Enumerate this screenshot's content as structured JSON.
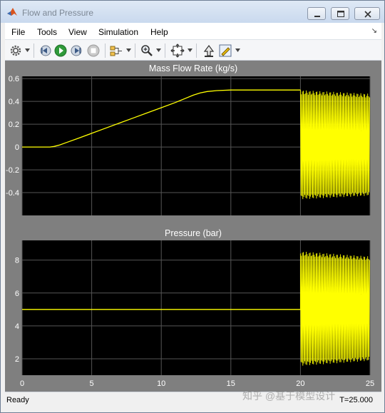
{
  "window": {
    "title": "Flow and Pressure"
  },
  "menu": {
    "items": [
      "File",
      "Tools",
      "View",
      "Simulation",
      "Help"
    ]
  },
  "toolbar": {
    "icons": [
      "gear-icon",
      "step-back-icon",
      "run-icon",
      "step-forward-icon",
      "stop-icon",
      "signal-select-icon",
      "zoom-icon",
      "fit-icon",
      "bring-to-front-icon",
      "highlight-icon"
    ]
  },
  "status": {
    "text": "Ready",
    "time": "T=25.000"
  },
  "watermark": "知乎 @基于模型设计",
  "colors": {
    "trace": "#ffff00",
    "plot_bg": "#000000",
    "frame_bg": "#7f7f7f",
    "grid": "#555555"
  },
  "chart_data": [
    {
      "type": "line",
      "title": "Mass Flow Rate (kg/s)",
      "xlim": [
        0,
        25
      ],
      "ylim": [
        -0.6,
        0.62
      ],
      "xticks": [
        0,
        5,
        10,
        15,
        20,
        25
      ],
      "yticks": [
        -0.4,
        -0.2,
        0,
        0.2,
        0.4,
        0.6
      ],
      "ytick_labels": [
        "-0.4",
        "-0.2",
        "0",
        "0.2",
        "0.4",
        "0.6"
      ],
      "show_xtick_labels": false,
      "grid": true,
      "series": [
        {
          "x": [
            0,
            2,
            2.3,
            2.7,
            3.2,
            4,
            5,
            6,
            7,
            8,
            9,
            10,
            11,
            11.7,
            12.3,
            12.8,
            13.3,
            14,
            15,
            16,
            17,
            18,
            19,
            20
          ],
          "y": [
            0,
            0,
            0.005,
            0.018,
            0.04,
            0.075,
            0.12,
            0.165,
            0.21,
            0.255,
            0.3,
            0.345,
            0.39,
            0.425,
            0.455,
            0.475,
            0.487,
            0.495,
            0.5,
            0.5,
            0.5,
            0.5,
            0.5,
            0.5
          ],
          "oscillation": {
            "from": 20,
            "to": 25,
            "center": 0.02,
            "amplitude_start": 0.46,
            "amplitude_end": 0.43,
            "period": 0.07
          }
        }
      ]
    },
    {
      "type": "line",
      "title": "Pressure (bar)",
      "xlim": [
        0,
        25
      ],
      "ylim": [
        1,
        9.2
      ],
      "xticks": [
        0,
        5,
        10,
        15,
        20,
        25
      ],
      "xtick_labels": [
        "0",
        "5",
        "10",
        "15",
        "20",
        "25"
      ],
      "yticks": [
        2,
        4,
        6,
        8
      ],
      "ytick_labels": [
        "2",
        "4",
        "6",
        "8"
      ],
      "grid": true,
      "series": [
        {
          "x": [
            0,
            20
          ],
          "y": [
            5,
            5
          ],
          "oscillation": {
            "from": 20,
            "to": 25,
            "center": 5.05,
            "amplitude_start": 3.35,
            "amplitude_end": 3.05,
            "period": 0.07
          }
        }
      ]
    }
  ]
}
